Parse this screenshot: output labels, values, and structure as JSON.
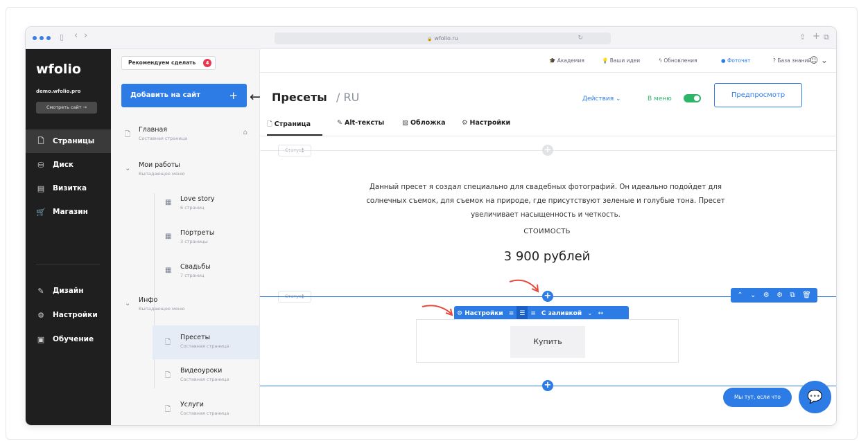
{
  "browser": {
    "url": "wfolio.ru",
    "lock_icon": "🔒",
    "reload_icon": "↻",
    "back_icon": "‹",
    "forward_icon": "›",
    "sidebar_toggle_icon": "▯",
    "share_icon": "⇪",
    "new_tab_icon": "+",
    "tabs_icon": "⧉"
  },
  "sidebar": {
    "logo": "wfolio",
    "domain": "demo.wfolio.pro",
    "view_site_button": "Смотреть сайт →",
    "nav": [
      {
        "label": "Страницы",
        "icon": "🗋"
      },
      {
        "label": "Диск",
        "icon": "⛁"
      },
      {
        "label": "Визитка",
        "icon": "▤"
      },
      {
        "label": "Магазин",
        "icon": "🛒"
      },
      {
        "label": "Дизайн",
        "icon": "✎"
      },
      {
        "label": "Настройки",
        "icon": "⚙"
      },
      {
        "label": "Обучение",
        "icon": "▣"
      }
    ]
  },
  "pages_panel": {
    "recommend_label": "Рекомендуем сделать",
    "recommend_count": "4",
    "add_button": "Добавить на сайт",
    "add_plus": "+",
    "items": [
      {
        "name": "Главная",
        "sub": "Составная страница",
        "icon": "🗋",
        "home": "⌂"
      },
      {
        "name": "Мои работы",
        "sub": "Выпадающее меню",
        "icon": "⌄"
      },
      {
        "name": "Love story",
        "sub": "6 страниц",
        "icon": "▦"
      },
      {
        "name": "Портреты",
        "sub": "3 страницы",
        "icon": "▦"
      },
      {
        "name": "Свадьбы",
        "sub": "7 страниц",
        "icon": "▦"
      },
      {
        "name": "Инфо",
        "sub": "Выпадающее меню",
        "icon": "⌄"
      },
      {
        "name": "Пресеты",
        "sub": "Составная страница",
        "icon": "🗋"
      },
      {
        "name": "Видеоуроки",
        "sub": "Составная страница",
        "icon": "🗋"
      },
      {
        "name": "Услуги",
        "sub": "Составная страница",
        "icon": "🗋"
      }
    ]
  },
  "topbar": {
    "links": [
      {
        "label": "Академия",
        "icon": "🎓"
      },
      {
        "label": "Ваши идеи",
        "icon": "💡"
      },
      {
        "label": "Обновления",
        "icon": "ϟ"
      },
      {
        "label": "Фоточат",
        "icon": "●"
      },
      {
        "label": "База знаний",
        "icon": "?"
      }
    ],
    "account_icon": "☺ ⌄"
  },
  "page_header": {
    "back_icon": "←",
    "title": "Пресеты",
    "lang": "/ RU",
    "actions": "Действия ⌄",
    "in_menu": "В меню",
    "preview_button": "Предпросмотр"
  },
  "tabs": [
    {
      "label": "Страница",
      "icon": "🗋"
    },
    {
      "label": "Alt-тексты",
      "icon": "✎"
    },
    {
      "label": "Обложка",
      "icon": "▨"
    },
    {
      "label": "Настройки",
      "icon": "⚙"
    }
  ],
  "content": {
    "status_label": "Статус",
    "status_arrow": "↕",
    "description": "Данный пресет я создал специально для свадебных фотографий. Он идеально подойдет для солнечных съемок, для съемок на природе, где присутствуют зеленые и голубые тона. Пресет увеличивает насыщенность и четкость.",
    "cost_label": "СТОИМОСТЬ",
    "price": "3 900 рублей",
    "plus": "+",
    "block_toolbar": {
      "settings": "⚙ Настройки",
      "align_left": "≡",
      "align_center": "☰",
      "align_right": "≡",
      "fill": "С заливкой",
      "dropdown": "⌄",
      "width": "↔"
    },
    "right_tools": [
      "⌃",
      "⌄",
      "⚙",
      "⚙",
      "⧉",
      "🗑"
    ],
    "buy_button": "Купить"
  },
  "chat": {
    "pill": "Мы тут, если что",
    "icon": "💬"
  }
}
